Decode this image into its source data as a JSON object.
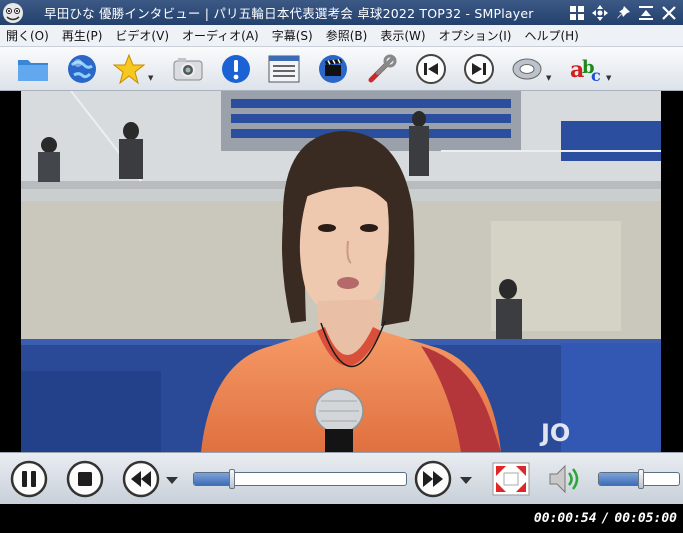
{
  "window": {
    "title": "早田ひな 優勝インタビュー | パリ五輪日本代表選考会 卓球2022 TOP32 - SMPlayer"
  },
  "menu": {
    "items": [
      {
        "label": "開く(O)"
      },
      {
        "label": "再生(P)"
      },
      {
        "label": "ビデオ(V)"
      },
      {
        "label": "オーディオ(A)"
      },
      {
        "label": "字幕(S)"
      },
      {
        "label": "参照(B)"
      },
      {
        "label": "表示(W)"
      },
      {
        "label": "オプション(I)"
      },
      {
        "label": "ヘルプ(H)"
      }
    ]
  },
  "toolbar": {
    "icons": [
      "folder-icon",
      "globe-icon",
      "favorites-star-icon",
      "screenshot-camera-icon",
      "info-icon",
      "playlist-icon",
      "video-clapper-icon",
      "preferences-tools-icon",
      "previous-icon",
      "next-icon",
      "audio-track-icon",
      "subtitles-icon"
    ]
  },
  "video": {
    "description_colors": {
      "jersey": "#f0824a",
      "seats": "#2a4da0",
      "wall": "#d9d4c8"
    }
  },
  "playback": {
    "current_time": "00:00:54",
    "total_time": "00:05:00",
    "separator": "/",
    "progress": 0.18,
    "volume": 0.52,
    "state": "playing"
  },
  "colors": {
    "titlebar": "#2d4a78",
    "accent": "#3f6eb8"
  }
}
